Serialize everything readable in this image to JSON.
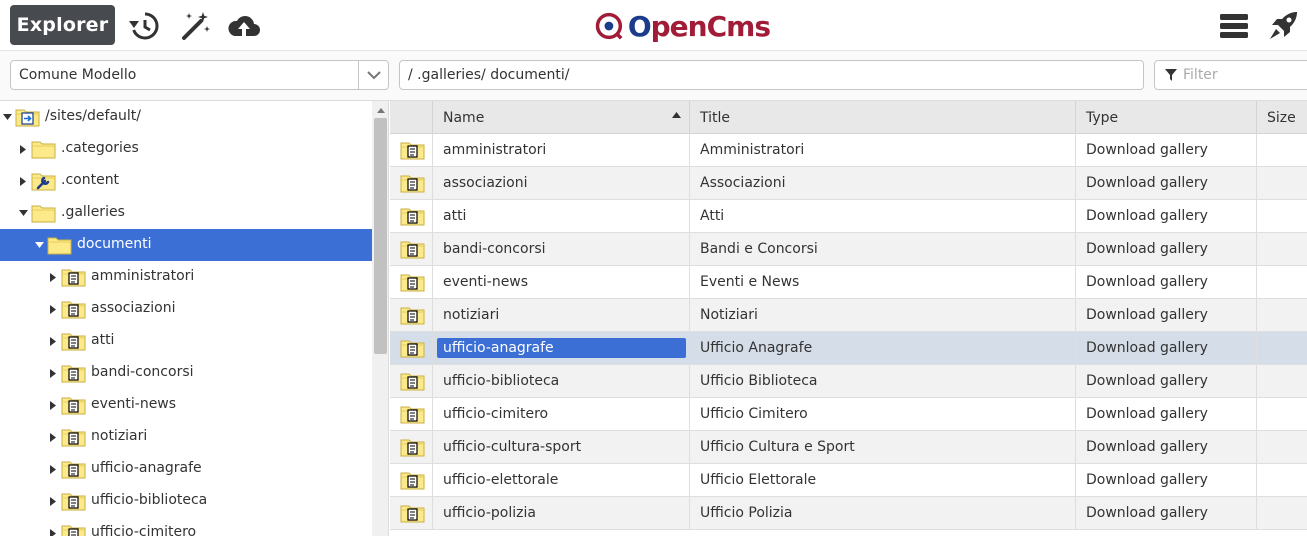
{
  "toolbar": {
    "app_label": "Explorer",
    "logo_text_o": "O",
    "logo_text_rest": "penCms"
  },
  "site_select": {
    "value": "Comune Modello"
  },
  "path": {
    "value": "/ .galleries/ documenti/"
  },
  "filter": {
    "placeholder": "Filter"
  },
  "tree": {
    "items": [
      {
        "label": "/sites/default/",
        "level": 0,
        "expanded": true,
        "icon": "site-folder-icon"
      },
      {
        "label": ".categories",
        "level": 1,
        "expanded": false,
        "icon": "folder-icon"
      },
      {
        "label": ".content",
        "level": 1,
        "expanded": false,
        "icon": "content-folder-icon"
      },
      {
        "label": ".galleries",
        "level": 1,
        "expanded": true,
        "icon": "folder-icon"
      },
      {
        "label": "documenti",
        "level": 2,
        "expanded": true,
        "icon": "folder-icon",
        "selected": true
      },
      {
        "label": "amministratori",
        "level": 3,
        "expanded": false,
        "icon": "gallery-folder-icon"
      },
      {
        "label": "associazioni",
        "level": 3,
        "expanded": false,
        "icon": "gallery-folder-icon"
      },
      {
        "label": "atti",
        "level": 3,
        "expanded": false,
        "icon": "gallery-folder-icon"
      },
      {
        "label": "bandi-concorsi",
        "level": 3,
        "expanded": false,
        "icon": "gallery-folder-icon"
      },
      {
        "label": "eventi-news",
        "level": 3,
        "expanded": false,
        "icon": "gallery-folder-icon"
      },
      {
        "label": "notiziari",
        "level": 3,
        "expanded": false,
        "icon": "gallery-folder-icon"
      },
      {
        "label": "ufficio-anagrafe",
        "level": 3,
        "expanded": false,
        "icon": "gallery-folder-icon"
      },
      {
        "label": "ufficio-biblioteca",
        "level": 3,
        "expanded": false,
        "icon": "gallery-folder-icon"
      },
      {
        "label": "ufficio-cimitero",
        "level": 3,
        "expanded": false,
        "icon": "gallery-folder-icon"
      }
    ]
  },
  "table": {
    "columns": {
      "name": "Name",
      "title": "Title",
      "type": "Type",
      "size": "Size"
    },
    "rows": [
      {
        "name": "amministratori",
        "title": "Amministratori",
        "type": "Download gallery"
      },
      {
        "name": "associazioni",
        "title": "Associazioni",
        "type": "Download gallery"
      },
      {
        "name": "atti",
        "title": "Atti",
        "type": "Download gallery"
      },
      {
        "name": "bandi-concorsi",
        "title": "Bandi e Concorsi",
        "type": "Download gallery"
      },
      {
        "name": "eventi-news",
        "title": "Eventi e News",
        "type": "Download gallery"
      },
      {
        "name": "notiziari",
        "title": "Notiziari",
        "type": "Download gallery"
      },
      {
        "name": "ufficio-anagrafe",
        "title": "Ufficio Anagrafe",
        "type": "Download gallery",
        "selected": true
      },
      {
        "name": "ufficio-biblioteca",
        "title": "Ufficio Biblioteca",
        "type": "Download gallery"
      },
      {
        "name": "ufficio-cimitero",
        "title": "Ufficio Cimitero",
        "type": "Download gallery"
      },
      {
        "name": "ufficio-cultura-sport",
        "title": "Ufficio Cultura e Sport",
        "type": "Download gallery"
      },
      {
        "name": "ufficio-elettorale",
        "title": "Ufficio Elettorale",
        "type": "Download gallery"
      },
      {
        "name": "ufficio-polizia",
        "title": "Ufficio Polizia",
        "type": "Download gallery"
      }
    ]
  },
  "colors": {
    "accent": "#3b6fd6",
    "app_button": "#474a4f",
    "logo_red": "#a01c37",
    "logo_blue": "#1a3c8a"
  }
}
